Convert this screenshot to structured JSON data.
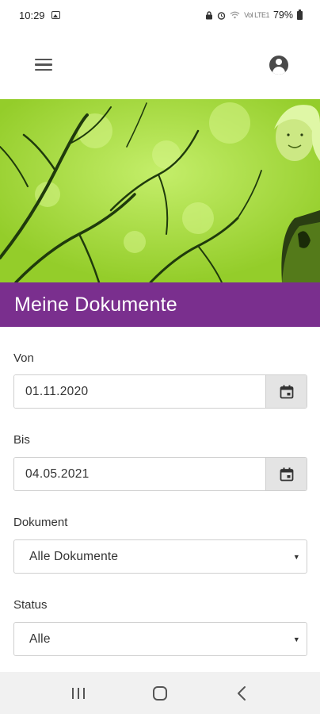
{
  "status_bar": {
    "time": "10:29",
    "battery_text": "79%",
    "signal_text": "Vol LTE1",
    "icons": [
      "gallery-icon",
      "alarm-icon",
      "wifi-icon",
      "signal-icon",
      "battery-icon"
    ]
  },
  "app_bar": {
    "menu_icon": "hamburger-menu-icon",
    "account_icon": "account-circle-icon"
  },
  "hero": {
    "accent_color": "#a4da36",
    "icon": "hero-photo"
  },
  "page": {
    "title": "Meine Dokumente",
    "title_band_color": "#7a2f8e"
  },
  "form": {
    "von": {
      "label": "Von",
      "value": "01.11.2020",
      "icon": "calendar-icon"
    },
    "bis": {
      "label": "Bis",
      "value": "04.05.2021",
      "icon": "calendar-icon"
    },
    "dokument": {
      "label": "Dokument",
      "selected": "Alle Dokumente"
    },
    "status": {
      "label": "Status",
      "selected": "Alle"
    }
  },
  "nav_bar": {
    "recents_icon": "recents-icon",
    "home_icon": "home-icon",
    "back_icon": "back-icon"
  }
}
